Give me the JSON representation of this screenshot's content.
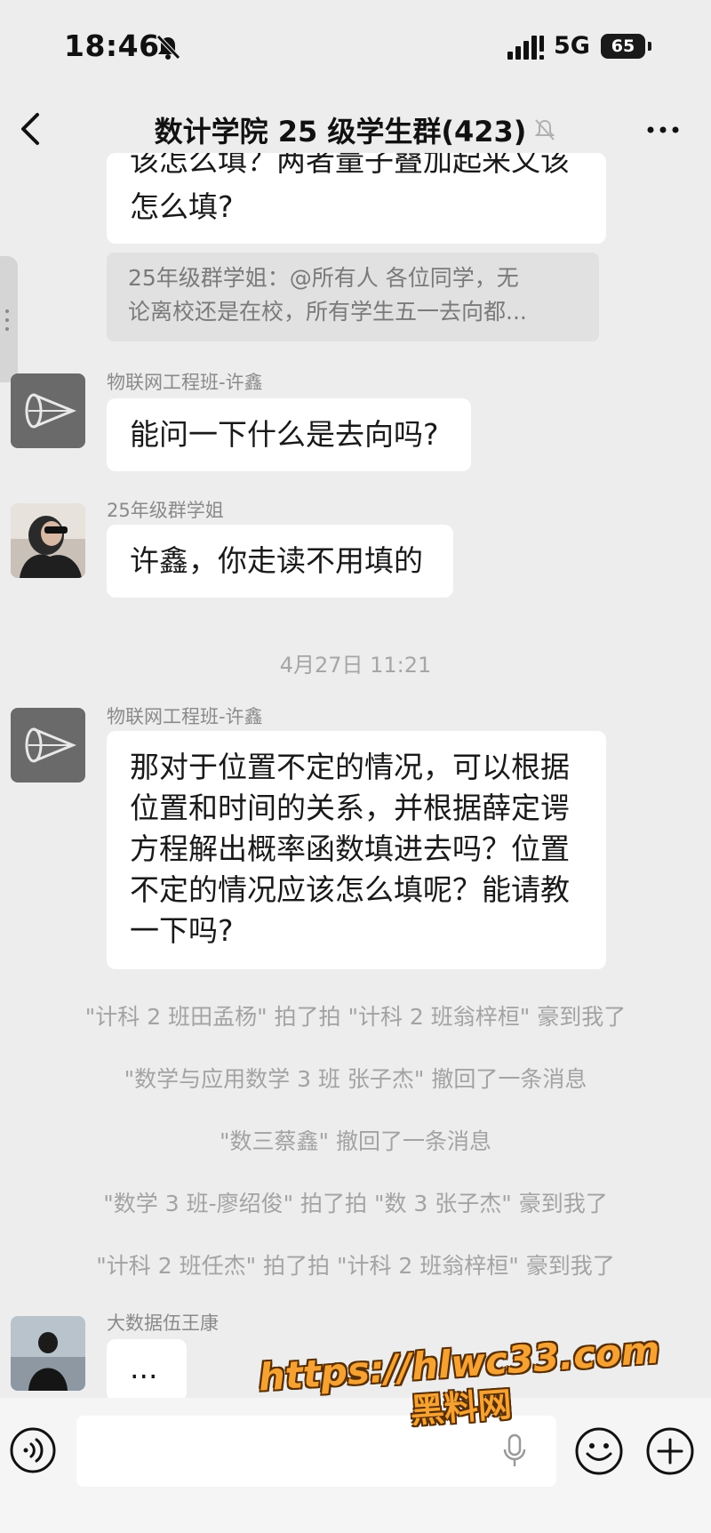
{
  "status_bar": {
    "time": "18:46",
    "network": "5G",
    "battery": "65"
  },
  "header": {
    "title": "数计学院 25 级学生群(423)"
  },
  "messages": {
    "prev_bubble": {
      "line1": "该怎么填？两者量子叠加起来又该",
      "line2": "怎么填?"
    },
    "quote": {
      "line1": "25年级群学姐：@所有人 各位同学，无",
      "line2": "论离校还是在校，所有学生五一去向都..."
    },
    "m1": {
      "sender": "物联网工程班-许鑫",
      "text": "能问一下什么是去向吗?"
    },
    "m2": {
      "sender": "25年级群学姐",
      "text": "许鑫，你走读不用填的"
    },
    "timestamp": "4月27日 11:21",
    "m3": {
      "sender": "物联网工程班-许鑫",
      "line1": "那对于位置不定的情况，可以根据",
      "line2": "位置和时间的关系，并根据薛定谔",
      "line3": "方程解出概率函数填进去吗？位置",
      "line4": "不定的情况应该怎么填呢？能请教",
      "line5": "一下吗?"
    },
    "system": [
      "\"计科 2 班田孟杨\" 拍了拍 \"计科 2 班翁梓桓\" 豪到我了",
      "\"数学与应用数学 3 班 张子杰\" 撤回了一条消息",
      "\"数三蔡鑫\" 撤回了一条消息",
      "\"数学 3 班-廖绍俊\" 拍了拍 \"数 3 张子杰\" 豪到我了",
      "\"计科 2 班任杰\" 拍了拍 \"计科 2 班翁梓桓\" 豪到我了"
    ],
    "m4": {
      "sender": "大数据伍王康",
      "text": "..."
    }
  },
  "watermark": {
    "line1": "https://hlwc33.com",
    "line2": "黑料网"
  },
  "icons": {
    "status": [
      "bell-off-icon",
      "signal-icon",
      "battery-icon"
    ],
    "nav": [
      "back-arrow-icon",
      "mute-icon",
      "more-icon"
    ],
    "input": [
      "voice-icon",
      "mic-icon",
      "emoji-icon",
      "plus-icon"
    ]
  }
}
